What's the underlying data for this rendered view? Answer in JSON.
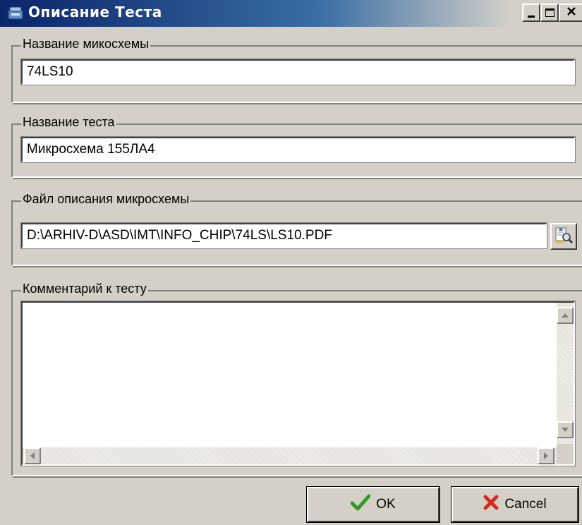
{
  "window": {
    "title": "Описание Теста",
    "controls": {
      "minimize_icon": "minimize-icon",
      "maximize_icon": "maximize-icon",
      "close_icon": "close-icon"
    }
  },
  "chip_name": {
    "label": "Название микосхемы",
    "value": "74LS10"
  },
  "test_name": {
    "label": "Название теста",
    "value": "Микросхема 155ЛА4"
  },
  "description_file": {
    "label": "Файл описания микросхемы",
    "value": "D:\\ARHIV-D\\ASD\\IMT\\INFO_CHIP\\74LS\\LS10.PDF",
    "browse_icon": "browse-file-icon"
  },
  "comment": {
    "label": "Комментарий к тесту",
    "value": ""
  },
  "buttons": {
    "ok_label": "OK",
    "cancel_label": "Cancel"
  },
  "colors": {
    "titlebar_start": "#0a246a",
    "titlebar_end": "#d4d0c8",
    "face": "#d4d0c8",
    "ok_check": "#2e9a1e",
    "cancel_x": "#d8281e"
  }
}
